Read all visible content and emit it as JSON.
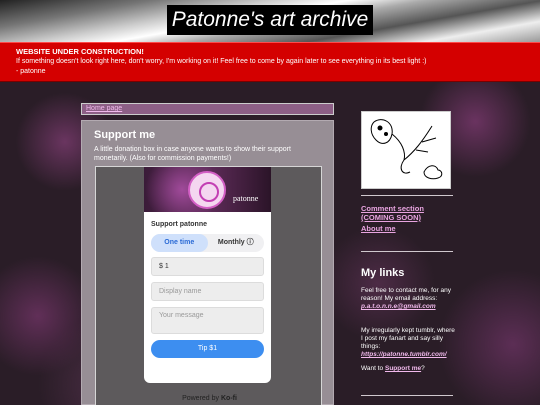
{
  "header": {
    "title": "Patonne's art archive"
  },
  "banner": {
    "heading": "WEBSITE UNDER CONSTRUCTION!",
    "message": "If something doesn't look right here, don't worry, I'm working on it! Feel free to come by again later to see everything in its best light :)",
    "signature": "- patonne"
  },
  "breadcrumb": {
    "link": "Home page"
  },
  "main": {
    "title": "Support me",
    "text": "A little donation box in case anyone wants to show their support monetarily. (Also for commission payments!)"
  },
  "kofi": {
    "avatar_name": "patonne",
    "support_label": "Support patonne",
    "freq_one_time": "One time",
    "freq_monthly": "Monthly ⓘ",
    "amount": "$ 1",
    "display_name_placeholder": "Display name",
    "message_placeholder": "Your message",
    "tip_button": "Tip $1",
    "powered_prefix": "Powered by",
    "powered_brand": "Ko-fi"
  },
  "sidebar": {
    "comment_link": "Comment section (COMING SOON)",
    "about_link": "About me",
    "links_heading": "My links",
    "contact_text": "Feel free to contact me, for any reason! My email address:",
    "email": "p.a.t.o.n.n.e@gmail.com",
    "tumblr_text": "My irregularly kept tumblr, where I post my fanart and say silly things:",
    "tumblr_link": "https://patonne.tumblr.com/",
    "support_prefix": "Want to",
    "support_link": "Support me",
    "support_suffix": "?"
  },
  "colors": {
    "banner": "#d40000",
    "link": "#f1b9ec",
    "tip_button": "#3d8ef0"
  }
}
